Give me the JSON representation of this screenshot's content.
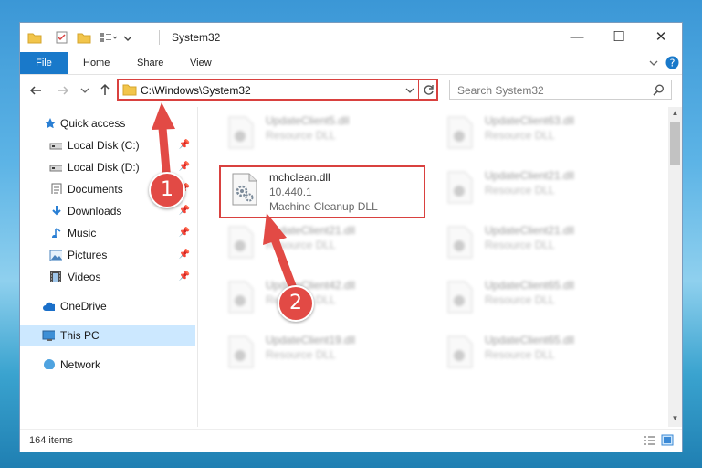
{
  "window": {
    "title": "System32",
    "controls": {
      "minimize": "—",
      "maximize": "☐",
      "close": "✕"
    }
  },
  "ribbon": {
    "tabs": [
      "File",
      "Home",
      "Share",
      "View"
    ]
  },
  "address_bar": {
    "path": "C:\\Windows\\System32",
    "search_placeholder": "Search System32"
  },
  "nav_pane": {
    "items": [
      {
        "label": "Quick access",
        "icon": "star-icon"
      },
      {
        "label": "Local Disk (C:)",
        "icon": "drive-icon",
        "pinned": true
      },
      {
        "label": "Local Disk (D:)",
        "icon": "drive-icon",
        "pinned": true
      },
      {
        "label": "Documents",
        "icon": "documents-icon",
        "pinned": true
      },
      {
        "label": "Downloads",
        "icon": "download-icon",
        "pinned": true
      },
      {
        "label": "Music",
        "icon": "music-icon",
        "pinned": true
      },
      {
        "label": "Pictures",
        "icon": "pictures-icon",
        "pinned": true
      },
      {
        "label": "Videos",
        "icon": "videos-icon",
        "pinned": true
      },
      {
        "label": "OneDrive",
        "icon": "cloud-icon"
      },
      {
        "label": "This PC",
        "icon": "computer-icon",
        "selected": true
      },
      {
        "label": "Network",
        "icon": "network-icon"
      }
    ]
  },
  "files": {
    "highlighted": {
      "name": "mchclean.dll",
      "version": "10.440.1",
      "description": "Machine Cleanup DLL"
    },
    "blurred": [
      {
        "name": "UpdateClient5.dll",
        "description": "Resource DLL"
      },
      {
        "name": "UpdateClient63.dll",
        "description": "Resource DLL"
      },
      {
        "name": "UpdateClient21.dll",
        "description": "Resource DLL"
      },
      {
        "name": "UpdateClient21.dll",
        "description": "Resource DLL"
      },
      {
        "name": "UpdateClient21.dll",
        "description": "Resource DLL"
      },
      {
        "name": "UpdateClient42.dll",
        "description": "Resource DLL"
      },
      {
        "name": "UpdateClient65.dll",
        "description": "Resource DLL"
      },
      {
        "name": "UpdateClient19.dll",
        "description": "Resource DLL"
      },
      {
        "name": "UpdateClient65.dll",
        "description": "Resource DLL"
      }
    ]
  },
  "status": {
    "item_count": "164 items"
  },
  "annotations": {
    "step1": "1",
    "step2": "2",
    "color": "#e24a45"
  }
}
